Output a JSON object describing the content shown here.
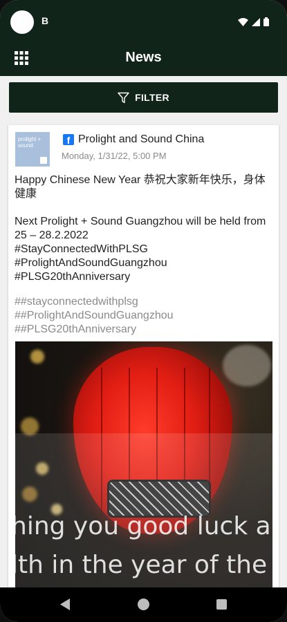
{
  "status_bar": {
    "notification_label": "B",
    "icons": [
      "wifi-icon",
      "signal-icon",
      "battery-icon"
    ]
  },
  "app_bar": {
    "title": "News",
    "menu_icon": "grid-menu-icon"
  },
  "filter": {
    "label": "FILTER",
    "icon": "funnel-icon"
  },
  "post": {
    "logo_text": "prolight + sound",
    "source_icon": "facebook-icon",
    "source": "Prolight and Sound China",
    "date": "Monday, 1/31/22, 5:00 PM",
    "text_line1": "Happy Chinese New Year  恭祝大家新年快乐，身体健康",
    "text_body": "Next Prolight + Sound Guangzhou will be held from 25 – 28.2.2022\n#StayConnectedWithPLSG\n#ProlightAndSoundGuangzhou\n#PLSG20thAnniversary",
    "hashtags": [
      "##stayconnectedwithplsg",
      "##ProlightAndSoundGuangzhou",
      "##PLSG20thAnniversary"
    ],
    "image_caption": "hing you good luck an\nlth in the year of the"
  },
  "nav_bar": {
    "icons": [
      "back-icon",
      "home-icon",
      "recents-icon"
    ]
  },
  "colors": {
    "brand_dark_green": "#10241a",
    "facebook_blue": "#1877f2",
    "hashtag_grey": "#8a8a8a"
  }
}
